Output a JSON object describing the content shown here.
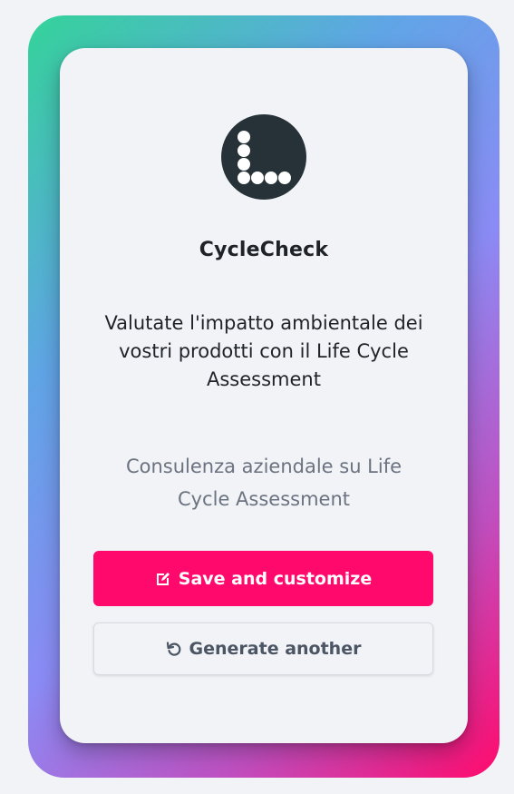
{
  "brand": {
    "name": "CycleCheck",
    "logo_icon": "dots-l-logo-icon"
  },
  "headline": "Valutate l'impatto ambientale dei vostri prodotti con il Life Cycle Assessment",
  "subline": "Consulenza aziendale su Life Cycle Assessment",
  "buttons": {
    "save_label": "Save and customize",
    "save_icon": "edit-icon",
    "generate_label": "Generate another",
    "generate_icon": "refresh-icon"
  },
  "colors": {
    "accent": "#ff0a6c",
    "logo_bg": "#263238",
    "card_bg": "#f1f3f7",
    "gradient": [
      "#34d399",
      "#60a5e6",
      "#8b8bf5",
      "#c04fc0",
      "#ff0a6c"
    ]
  }
}
